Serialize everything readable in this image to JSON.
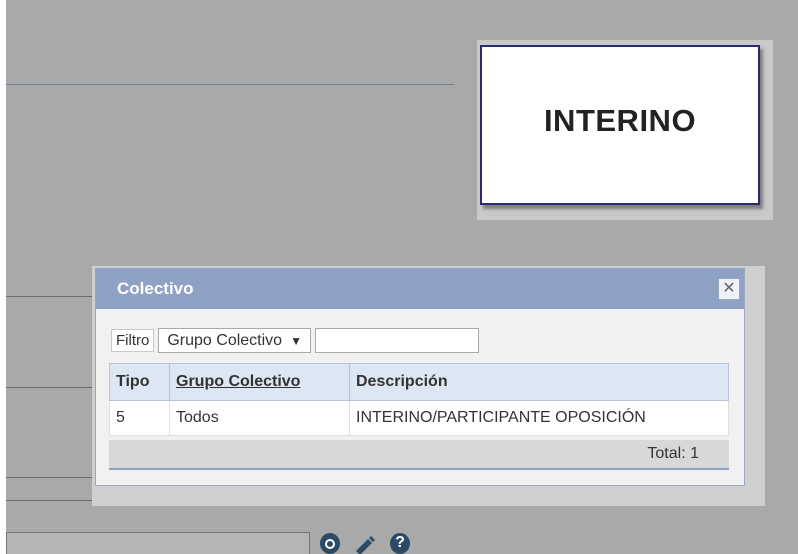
{
  "badge": {
    "text": "INTERINO"
  },
  "dialog": {
    "title": "Colectivo",
    "close_symbol": "✕",
    "filter": {
      "label": "Filtro",
      "selected_option": "Grupo Colectivo",
      "select_arrow": "▼",
      "input_value": ""
    },
    "columns": [
      "Tipo",
      "Grupo Colectivo",
      "Descripción"
    ],
    "rows": [
      {
        "tipo": "5",
        "grupo": "Todos",
        "descripcion": "INTERINO/PARTICIPANTE OPOSICIÓN"
      }
    ],
    "total": "Total: 1"
  },
  "toolbar_icons": {
    "view": "eye-icon",
    "edit": "pencil-icon",
    "help": "help-icon",
    "help_glyph": "?"
  },
  "colors": {
    "dialog_header": "#8fa2c6",
    "table_header": "#dde6f3",
    "badge_border": "#2a2a6e"
  }
}
